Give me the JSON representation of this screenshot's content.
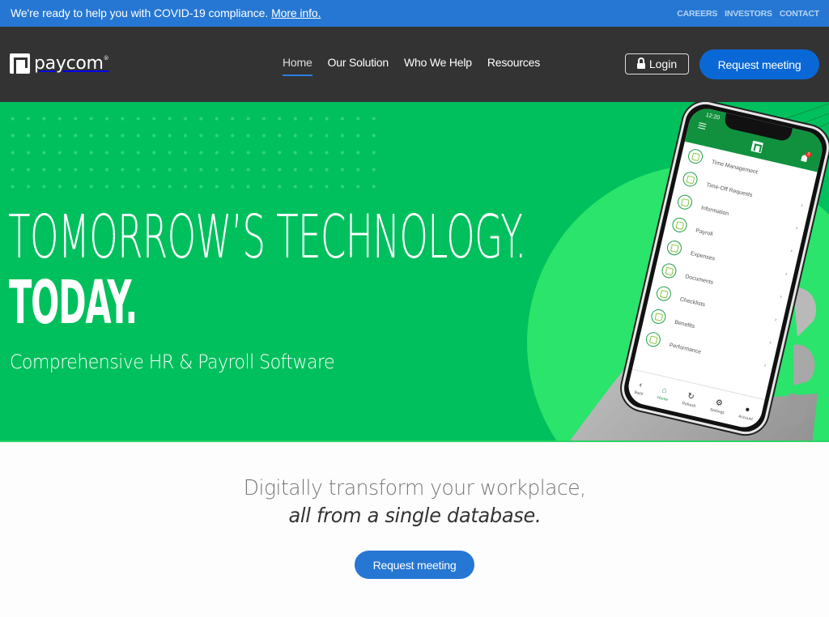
{
  "announcement": {
    "message": "We're ready to help you with COVID-19 compliance.",
    "link_label": "More info."
  },
  "utility_links": [
    "CAREERS",
    "INVESTORS",
    "CONTACT"
  ],
  "brand": {
    "name": "paycom",
    "trademark": "®"
  },
  "nav": {
    "items": [
      {
        "label": "Home",
        "active": true
      },
      {
        "label": "Our Solution",
        "active": false
      },
      {
        "label": "Who We Help",
        "active": false
      },
      {
        "label": "Resources",
        "active": false
      }
    ],
    "login_label": "Login",
    "request_label": "Request meeting"
  },
  "hero": {
    "headline_line1": "TOMORROW’S TECHNOLOGY.",
    "headline_line2": "TODAY.",
    "subheadline": "Comprehensive HR & Payroll Software"
  },
  "phone_app": {
    "time": "12:20",
    "notification_count": "3",
    "menu_items": [
      {
        "label": "Time Management",
        "icon": "clock-icon"
      },
      {
        "label": "Time-Off Requests",
        "icon": "calendar-icon"
      },
      {
        "label": "Information",
        "icon": "fingerprint-icon"
      },
      {
        "label": "Payroll",
        "icon": "dollar-icon"
      },
      {
        "label": "Expenses",
        "icon": "credit-card-icon"
      },
      {
        "label": "Documents",
        "icon": "document-icon"
      },
      {
        "label": "Checklists",
        "icon": "checkmark-icon"
      },
      {
        "label": "Benefits",
        "icon": "plus-cross-icon"
      },
      {
        "label": "Performance",
        "icon": "rocket-icon"
      }
    ],
    "tabs": [
      {
        "label": "Back",
        "glyph": "‹",
        "active": false
      },
      {
        "label": "Home",
        "glyph": "⌂",
        "active": true
      },
      {
        "label": "Refresh",
        "glyph": "↻",
        "active": false
      },
      {
        "label": "Settings",
        "glyph": "⚙",
        "active": false
      },
      {
        "label": "Account",
        "glyph": "●",
        "active": false
      }
    ]
  },
  "tagline": {
    "line1": "Digitally transform your workplace,",
    "line2": "all from a single database."
  },
  "cta": {
    "label": "Request meeting"
  },
  "colors": {
    "announcement_bg": "#2677d3",
    "nav_bg": "#333333",
    "brand_blue": "#0a68d6",
    "hero_green": "#00c05d",
    "circle_green": "#2ae46b",
    "app_green": "#11913e"
  }
}
